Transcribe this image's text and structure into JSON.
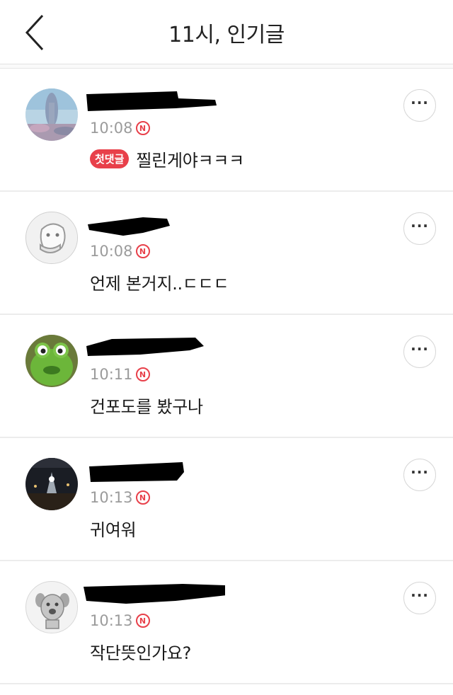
{
  "header": {
    "title": "11시, 인기글",
    "back_icon": "chevron-left-icon"
  },
  "colors": {
    "accent": "#e8404a",
    "time": "#9b9b9b",
    "divider": "#ececec"
  },
  "comments": [
    {
      "time": "10:08",
      "n_badge": "N",
      "first_badge": "첫댓글",
      "text": "찔린게야ㅋㅋㅋ",
      "avatar_icon": "landscape-avatar"
    },
    {
      "time": "10:08",
      "n_badge": "N",
      "first_badge": "",
      "text": "언제 본거지..ㄷㄷㄷ",
      "avatar_icon": "default-face-avatar"
    },
    {
      "time": "10:11",
      "n_badge": "N",
      "first_badge": "",
      "text": "건포도를 봤구나",
      "avatar_icon": "frog-avatar"
    },
    {
      "time": "10:13",
      "n_badge": "N",
      "first_badge": "",
      "text": "귀여워",
      "avatar_icon": "concert-avatar"
    },
    {
      "time": "10:13",
      "n_badge": "N",
      "first_badge": "",
      "text": "작단뜻인가요?",
      "avatar_icon": "dog-avatar"
    }
  ]
}
